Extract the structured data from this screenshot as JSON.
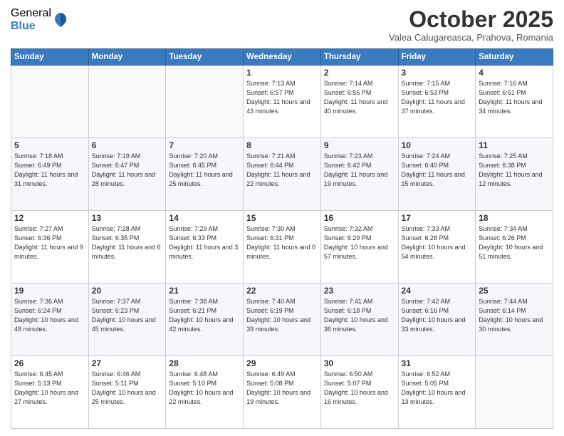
{
  "logo": {
    "general": "General",
    "blue": "Blue"
  },
  "header": {
    "month": "October 2025",
    "location": "Valea Calugareasca, Prahova, Romania"
  },
  "days_of_week": [
    "Sunday",
    "Monday",
    "Tuesday",
    "Wednesday",
    "Thursday",
    "Friday",
    "Saturday"
  ],
  "weeks": [
    [
      {
        "day": "",
        "info": ""
      },
      {
        "day": "",
        "info": ""
      },
      {
        "day": "",
        "info": ""
      },
      {
        "day": "1",
        "info": "Sunrise: 7:13 AM\nSunset: 6:57 PM\nDaylight: 11 hours and 43 minutes."
      },
      {
        "day": "2",
        "info": "Sunrise: 7:14 AM\nSunset: 6:55 PM\nDaylight: 11 hours and 40 minutes."
      },
      {
        "day": "3",
        "info": "Sunrise: 7:15 AM\nSunset: 6:53 PM\nDaylight: 11 hours and 37 minutes."
      },
      {
        "day": "4",
        "info": "Sunrise: 7:16 AM\nSunset: 6:51 PM\nDaylight: 11 hours and 34 minutes."
      }
    ],
    [
      {
        "day": "5",
        "info": "Sunrise: 7:18 AM\nSunset: 6:49 PM\nDaylight: 11 hours and 31 minutes."
      },
      {
        "day": "6",
        "info": "Sunrise: 7:19 AM\nSunset: 6:47 PM\nDaylight: 11 hours and 28 minutes."
      },
      {
        "day": "7",
        "info": "Sunrise: 7:20 AM\nSunset: 6:45 PM\nDaylight: 11 hours and 25 minutes."
      },
      {
        "day": "8",
        "info": "Sunrise: 7:21 AM\nSunset: 6:44 PM\nDaylight: 11 hours and 22 minutes."
      },
      {
        "day": "9",
        "info": "Sunrise: 7:23 AM\nSunset: 6:42 PM\nDaylight: 11 hours and 19 minutes."
      },
      {
        "day": "10",
        "info": "Sunrise: 7:24 AM\nSunset: 6:40 PM\nDaylight: 11 hours and 15 minutes."
      },
      {
        "day": "11",
        "info": "Sunrise: 7:25 AM\nSunset: 6:38 PM\nDaylight: 11 hours and 12 minutes."
      }
    ],
    [
      {
        "day": "12",
        "info": "Sunrise: 7:27 AM\nSunset: 6:36 PM\nDaylight: 11 hours and 9 minutes."
      },
      {
        "day": "13",
        "info": "Sunrise: 7:28 AM\nSunset: 6:35 PM\nDaylight: 11 hours and 6 minutes."
      },
      {
        "day": "14",
        "info": "Sunrise: 7:29 AM\nSunset: 6:33 PM\nDaylight: 11 hours and 3 minutes."
      },
      {
        "day": "15",
        "info": "Sunrise: 7:30 AM\nSunset: 6:31 PM\nDaylight: 11 hours and 0 minutes."
      },
      {
        "day": "16",
        "info": "Sunrise: 7:32 AM\nSunset: 6:29 PM\nDaylight: 10 hours and 57 minutes."
      },
      {
        "day": "17",
        "info": "Sunrise: 7:33 AM\nSunset: 6:28 PM\nDaylight: 10 hours and 54 minutes."
      },
      {
        "day": "18",
        "info": "Sunrise: 7:34 AM\nSunset: 6:26 PM\nDaylight: 10 hours and 51 minutes."
      }
    ],
    [
      {
        "day": "19",
        "info": "Sunrise: 7:36 AM\nSunset: 6:24 PM\nDaylight: 10 hours and 48 minutes."
      },
      {
        "day": "20",
        "info": "Sunrise: 7:37 AM\nSunset: 6:23 PM\nDaylight: 10 hours and 45 minutes."
      },
      {
        "day": "21",
        "info": "Sunrise: 7:38 AM\nSunset: 6:21 PM\nDaylight: 10 hours and 42 minutes."
      },
      {
        "day": "22",
        "info": "Sunrise: 7:40 AM\nSunset: 6:19 PM\nDaylight: 10 hours and 39 minutes."
      },
      {
        "day": "23",
        "info": "Sunrise: 7:41 AM\nSunset: 6:18 PM\nDaylight: 10 hours and 36 minutes."
      },
      {
        "day": "24",
        "info": "Sunrise: 7:42 AM\nSunset: 6:16 PM\nDaylight: 10 hours and 33 minutes."
      },
      {
        "day": "25",
        "info": "Sunrise: 7:44 AM\nSunset: 6:14 PM\nDaylight: 10 hours and 30 minutes."
      }
    ],
    [
      {
        "day": "26",
        "info": "Sunrise: 6:45 AM\nSunset: 5:13 PM\nDaylight: 10 hours and 27 minutes."
      },
      {
        "day": "27",
        "info": "Sunrise: 6:46 AM\nSunset: 5:11 PM\nDaylight: 10 hours and 25 minutes."
      },
      {
        "day": "28",
        "info": "Sunrise: 6:48 AM\nSunset: 5:10 PM\nDaylight: 10 hours and 22 minutes."
      },
      {
        "day": "29",
        "info": "Sunrise: 6:49 AM\nSunset: 5:08 PM\nDaylight: 10 hours and 19 minutes."
      },
      {
        "day": "30",
        "info": "Sunrise: 6:50 AM\nSunset: 5:07 PM\nDaylight: 10 hours and 16 minutes."
      },
      {
        "day": "31",
        "info": "Sunrise: 6:52 AM\nSunset: 5:05 PM\nDaylight: 10 hours and 13 minutes."
      },
      {
        "day": "",
        "info": ""
      }
    ]
  ]
}
